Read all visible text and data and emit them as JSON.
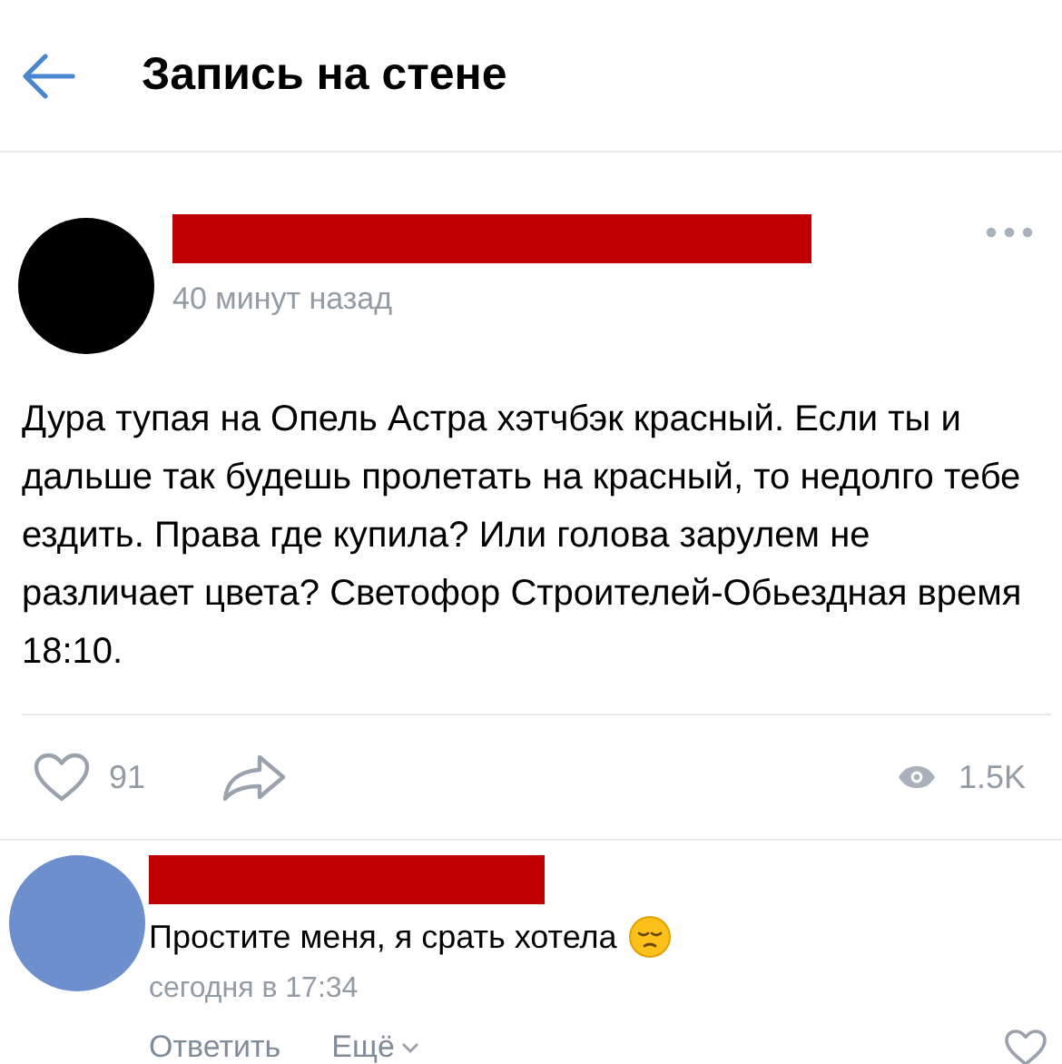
{
  "header": {
    "title": "Запись на стене"
  },
  "post": {
    "time": "40 минут назад",
    "text": "Дура тупая на Опель Астра хэтчбэк красный. Если ты и дальше так будешь пролетать на красный, то недолго тебе ездить. Права где купила? Или голова зарулем не различает цвета? Светофор Строителей-Обьездная время 18:10.",
    "likes": "91",
    "liked": false,
    "views": "1.5K"
  },
  "comment": {
    "text": "Простите меня, я срать хотела",
    "time": "сегодня в 17:34",
    "actions": [
      "Ответить",
      "Ещё"
    ],
    "liked": false
  }
}
